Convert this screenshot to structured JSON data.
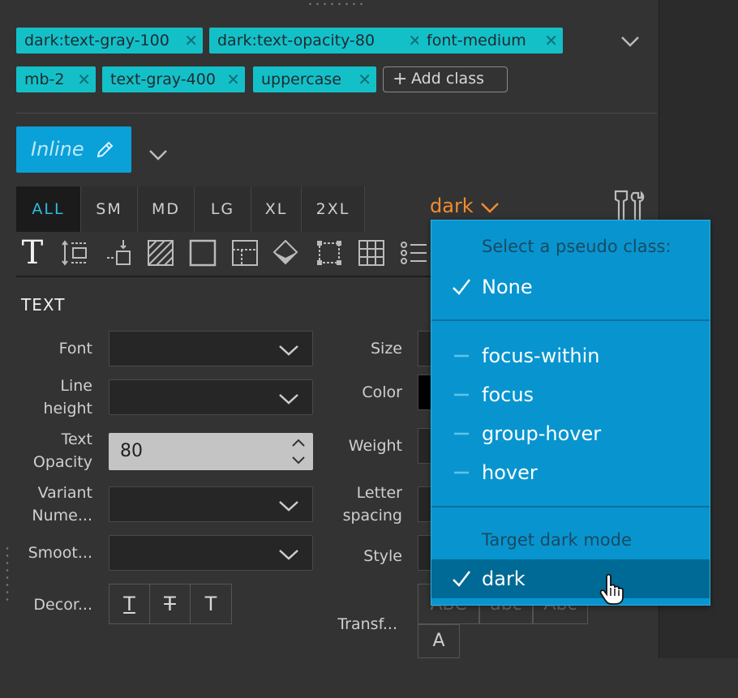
{
  "class_tags": [
    {
      "label": "dark:text-gray-100",
      "remove_icon": "close-icon"
    },
    {
      "label": "dark:text-opacity-80",
      "remove_icon": "close-icon"
    },
    {
      "label": "font-medium",
      "remove_icon": "close-icon"
    },
    {
      "label": "mb-2",
      "remove_icon": "close-icon"
    },
    {
      "label": "text-gray-400",
      "remove_icon": "close-icon"
    },
    {
      "label": "uppercase",
      "remove_icon": "close-icon"
    }
  ],
  "add_class_label": "Add class",
  "inline_button_label": "Inline",
  "breakpoints": [
    "ALL",
    "SM",
    "MD",
    "LG",
    "XL",
    "2XL"
  ],
  "active_breakpoint": "ALL",
  "pseudo_toggle_label": "dark",
  "section_title": "TEXT",
  "fields": {
    "font": "Font",
    "line_height_1": "Line",
    "line_height_2": "height",
    "text_opacity_1": "Text",
    "text_opacity_2": "Opacity",
    "text_opacity_value": "80",
    "variant_1": "Variant",
    "variant_2": "Nume...",
    "smoothing": "Smoot...",
    "decoration": "Decor...",
    "size": "Size",
    "color": "Color",
    "weight": "Weight",
    "letter_spacing_1": "Letter",
    "letter_spacing_2": "spacing",
    "style": "Style",
    "transform": "Transf..."
  },
  "decoration_options": [
    "T",
    "T",
    "T"
  ],
  "transform_options": [
    "ABC",
    "abc",
    "Abc",
    "A"
  ],
  "dropdown": {
    "heading": "Select a pseudo class:",
    "none_label": "None",
    "pseudo_classes": [
      "focus-within",
      "focus",
      "group-hover",
      "hover"
    ],
    "dark_heading": "Target dark mode",
    "dark_label": "dark"
  },
  "colors": {
    "accent_teal": "#14c0c8",
    "accent_blue": "#0aa0d8",
    "dark_orange": "#f08c30",
    "dropdown_bg": "#0895cf",
    "dropdown_selected": "#006a96"
  }
}
